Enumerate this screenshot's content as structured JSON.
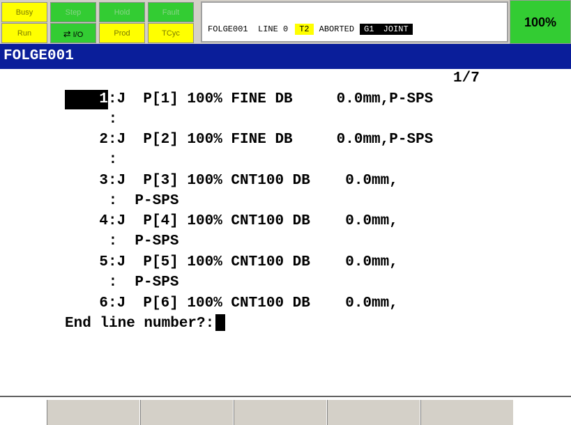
{
  "status_leds": [
    {
      "label": "Busy",
      "color": "#ffff00"
    },
    {
      "label": "Step",
      "color": "#33cc33"
    },
    {
      "label": "Hold",
      "color": "#33cc33"
    },
    {
      "label": "Fault",
      "color": "#33cc33"
    },
    {
      "label": "Run",
      "color": "#ffff00"
    },
    {
      "label": "I/O",
      "color": "#33cc33"
    },
    {
      "label": "Prod",
      "color": "#ffff00"
    },
    {
      "label": "TCyc",
      "color": "#ffff00"
    }
  ],
  "status": {
    "program": "FOLGE001",
    "line_label": "LINE 0",
    "mode": "T2",
    "state": "ABORTED",
    "group": "G1",
    "coord": "JOINT"
  },
  "override": "100%",
  "title": "FOLGE001",
  "position_indicator": "1/7",
  "program_lines": [
    {
      "num": "1",
      "text": ":J  P[1] 100% FINE DB     0.0mm,P-SPS"
    },
    {
      "num": "",
      "text": " :"
    },
    {
      "num": "2",
      "text": ":J  P[2] 100% FINE DB     0.0mm,P-SPS"
    },
    {
      "num": "",
      "text": " :"
    },
    {
      "num": "3",
      "text": ":J  P[3] 100% CNT100 DB    0.0mm,"
    },
    {
      "num": "",
      "text": " :  P-SPS"
    },
    {
      "num": "4",
      "text": ":J  P[4] 100% CNT100 DB    0.0mm,"
    },
    {
      "num": "",
      "text": " :  P-SPS"
    },
    {
      "num": "5",
      "text": ":J  P[5] 100% CNT100 DB    0.0mm,"
    },
    {
      "num": "",
      "text": " :  P-SPS"
    },
    {
      "num": "6",
      "text": ":J  P[6] 100% CNT100 DB    0.0mm,"
    }
  ],
  "prompt": "End line number?:",
  "function_keys": [
    "",
    "",
    "",
    "",
    ""
  ]
}
